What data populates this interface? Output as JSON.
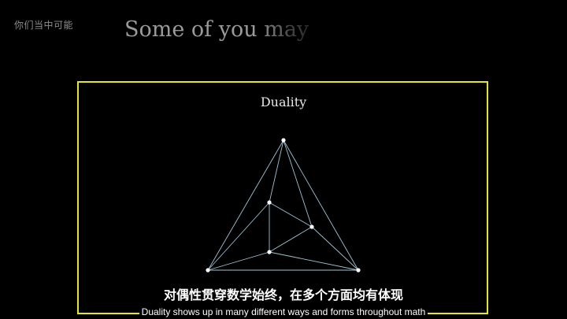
{
  "overlay": {
    "top_left_caption": "你们当中可能",
    "heading": "Some of you may"
  },
  "panel": {
    "title": "Duality",
    "frame_color": "#e6e628"
  },
  "graph": {
    "edge_color": "#9fc3d4",
    "vertex_color": "#ffffff"
  },
  "subtitles": {
    "zh": "对偶性贯穿数学始终，在多个方面均有体现",
    "en": "Duality shows up in many different ways and forms throughout math"
  }
}
